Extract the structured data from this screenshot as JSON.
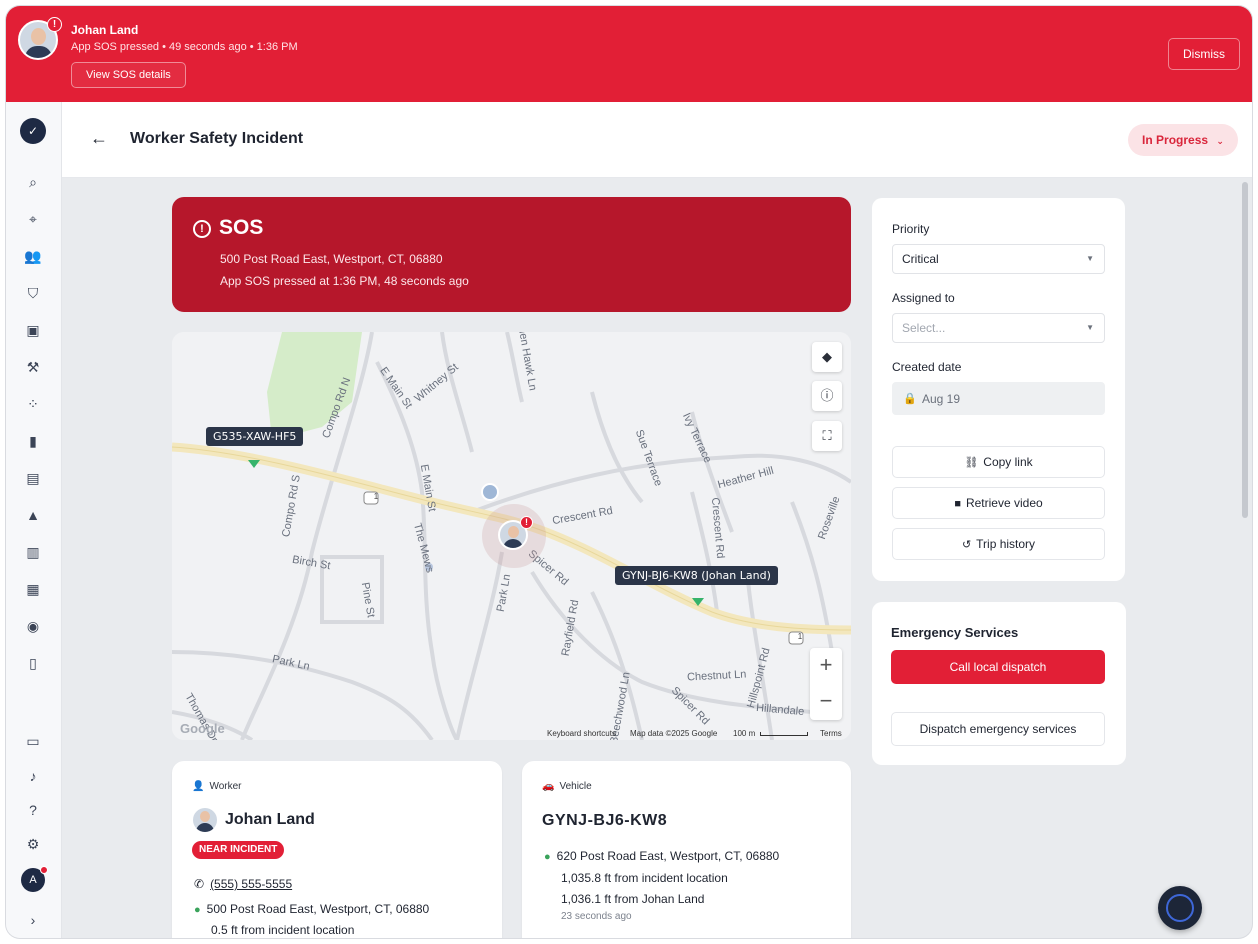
{
  "banner": {
    "name": "Johan Land",
    "subtitle": "App SOS pressed • 49 seconds ago • 1:36 PM",
    "details_label": "View SOS details",
    "dismiss_label": "Dismiss",
    "badge": "!"
  },
  "header": {
    "title": "Worker Safety Incident",
    "status": "In Progress"
  },
  "sidebar": {
    "user_initial": "A",
    "icons": [
      "search-icon",
      "map-pin-icon",
      "users-icon",
      "shield-icon",
      "clipboard-icon",
      "wrench-icon",
      "route-icon",
      "fuel-icon",
      "document-icon",
      "graduation-cap-icon",
      "bar-chart-icon",
      "form-icon",
      "target-icon",
      "mobile-icon",
      "chat-icon",
      "bell-icon",
      "help-icon",
      "gear-icon",
      "chevron-right-icon"
    ]
  },
  "sos": {
    "title": "SOS",
    "address": "500 Post Road East, Westport, CT, 06880",
    "time": "App SOS pressed at 1:36 PM, 48 seconds ago"
  },
  "map": {
    "tag_vehicle_1": "G535-XAW-HF5",
    "tag_vehicle_2": "GYNJ-BJ6-KW8 (Johan Land)",
    "streets": [
      "Compo Rd N",
      "E Main St",
      "Whitney St",
      "Hen Hawk Ln",
      "Sue Terrace",
      "Ivy Terrace",
      "Heather Hill",
      "Crescent Rd",
      "Crescent Rd",
      "Compo Rd S",
      "E Main St",
      "The Mews",
      "Birch St",
      "Pine St",
      "Park Ln",
      "Spicer Rd",
      "Park Ln",
      "Rayfield Rd",
      "Chestnut Ln",
      "Beechwood Ln",
      "Spicer Rd",
      "Hillspoint Rd",
      "Hillandale",
      "Roseville",
      "Thomas Dr"
    ],
    "route_shields": [
      "1",
      "1"
    ],
    "footer": {
      "google": "Google",
      "shortcuts": "Keyboard shortcuts",
      "map_data": "Map data ©2025 Google",
      "scale": "100 m",
      "terms": "Terms"
    }
  },
  "worker": {
    "kicker": "Worker",
    "name": "Johan Land",
    "badge": "NEAR INCIDENT",
    "phone": "(555) 555-5555",
    "address": "500 Post Road East, Westport, CT, 06880",
    "distance": "0.5 ft from incident location"
  },
  "vehicle": {
    "kicker": "Vehicle",
    "id": "GYNJ-BJ6-KW8",
    "address": "620 Post Road East, Westport, CT, 06880",
    "distance_incident": "1,035.8 ft from incident location",
    "distance_worker": "1,036.1 ft from Johan Land",
    "updated": "23 seconds ago"
  },
  "details": {
    "priority_label": "Priority",
    "priority_value": "Critical",
    "assigned_label": "Assigned to",
    "assigned_placeholder": "Select...",
    "created_label": "Created date",
    "created_value": "Aug 19",
    "copy_link": "Copy link",
    "retrieve_video": "Retrieve video",
    "trip_history": "Trip history"
  },
  "emergency": {
    "title": "Emergency Services",
    "call_label": "Call local dispatch",
    "dispatch_label": "Dispatch emergency services"
  },
  "colors": {
    "alert_red": "#e21f36",
    "sos_card": "#b6172b",
    "status_pill_bg": "#fbe3e6"
  }
}
